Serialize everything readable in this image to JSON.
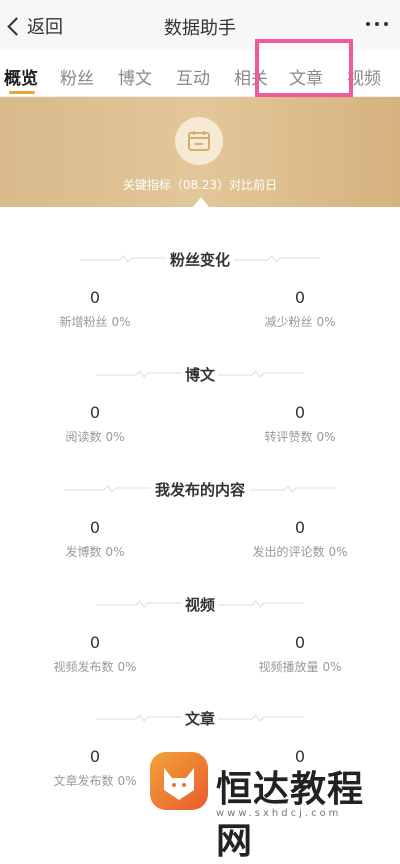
{
  "nav": {
    "back_label": "返回",
    "title": "数据助手"
  },
  "tabs": [
    "概览",
    "粉丝",
    "博文",
    "互动",
    "相关",
    "文章",
    "视频"
  ],
  "banner": {
    "text": "关键指标（08.23）对比前日"
  },
  "sections": [
    {
      "title": "粉丝变化",
      "left": {
        "value": "0",
        "label": "新增粉丝",
        "pct": "0%"
      },
      "right": {
        "value": "0",
        "label": "减少粉丝",
        "pct": "0%"
      }
    },
    {
      "title": "博文",
      "left": {
        "value": "0",
        "label": "阅读数",
        "pct": "0%"
      },
      "right": {
        "value": "0",
        "label": "转评赞数",
        "pct": "0%"
      }
    },
    {
      "title": "我发布的内容",
      "left": {
        "value": "0",
        "label": "发博数",
        "pct": "0%"
      },
      "right": {
        "value": "0",
        "label": "发出的评论数",
        "pct": "0%"
      }
    },
    {
      "title": "视频",
      "left": {
        "value": "0",
        "label": "视频发布数",
        "pct": "0%"
      },
      "right": {
        "value": "0",
        "label": "视频播放量",
        "pct": "0%"
      }
    },
    {
      "title": "文章",
      "left": {
        "value": "0",
        "label": "文章发布数",
        "pct": "0%"
      },
      "right": {
        "value": "0",
        "label": "",
        "pct": ""
      }
    }
  ],
  "watermark": {
    "brand": "恒达教程网",
    "url": "www.sxhdcj.com"
  },
  "colors": {
    "accent": "#e8a33b",
    "highlight": "#ee5a9c",
    "banner": "#dcbf8f"
  }
}
